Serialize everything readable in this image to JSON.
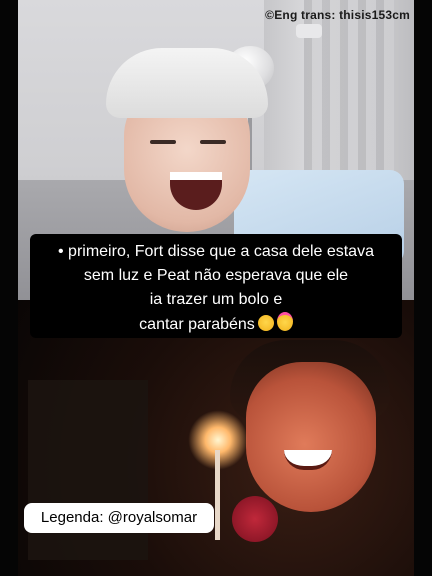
{
  "watermark": {
    "credit": "©Eng trans:  thisis153cm"
  },
  "caption": {
    "line1": "• primeiro, Fort disse que a casa dele estava",
    "line2": "sem luz e Peat não esperava que ele",
    "line3": "ia trazer um bolo e",
    "line4": "cantar parabéns",
    "emojis": [
      "pleading-face-emoji",
      "partying-face-emoji"
    ]
  },
  "legenda": {
    "text": "Legenda: @royalsomar"
  },
  "colors": {
    "background": "#000000",
    "caption_bg": "#000000",
    "caption_text": "#ffffff",
    "legenda_bg": "#ffffff"
  }
}
